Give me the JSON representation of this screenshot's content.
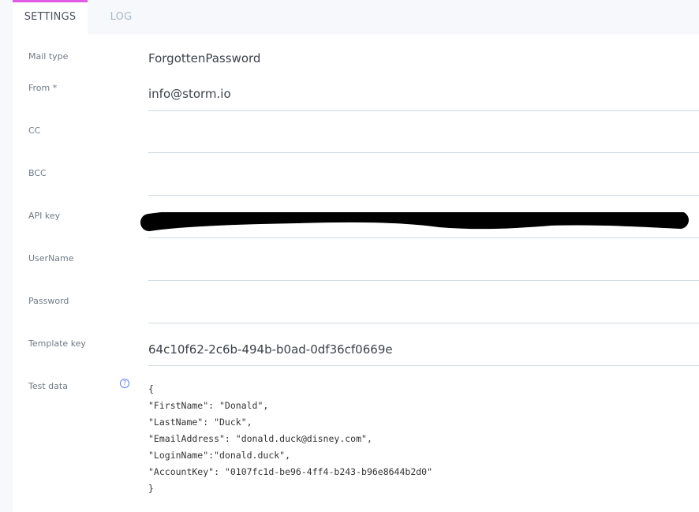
{
  "tabs": [
    {
      "label": "SETTINGS",
      "active": true
    },
    {
      "label": "LOG",
      "active": false
    }
  ],
  "colors": {
    "tab_accent": "#e05ce6",
    "help_icon": "#5b7ef0"
  },
  "form": {
    "mail_type": {
      "label": "Mail type",
      "value": "ForgottenPassword"
    },
    "from": {
      "label": "From *",
      "value": "info@storm.io"
    },
    "cc": {
      "label": "CC",
      "value": ""
    },
    "bcc": {
      "label": "BCC",
      "value": ""
    },
    "api_key": {
      "label": "API key",
      "value": "[redacted]"
    },
    "username": {
      "label": "UserName",
      "value": ""
    },
    "password": {
      "label": "Password",
      "value": ""
    },
    "template_key": {
      "label": "Template key",
      "value": "64c10f62-2c6b-494b-b0ad-0df36cf0669e"
    },
    "test_data": {
      "label": "Test data",
      "help_icon": "question-circle-icon",
      "lines": [
        "{",
        "\"FirstName\": \"Donald\",",
        "\"LastName\": \"Duck\",",
        "\"EmailAddress\": \"donald.duck@disney.com\",",
        "\"LoginName\":\"donald.duck\",",
        "\"AccountKey\": \"0107fc1d-be96-4ff4-b243-b96e8644b2d0\"",
        "}"
      ]
    }
  }
}
